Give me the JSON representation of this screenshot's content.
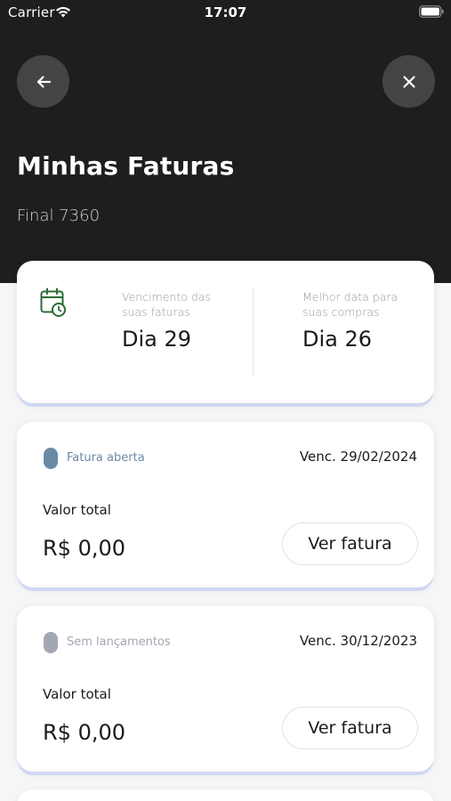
{
  "status_bar": {
    "carrier": "Carrier",
    "time": "17:07"
  },
  "header": {
    "back_icon": "arrow-left-icon",
    "close_icon": "close-icon",
    "title": "Minhas Faturas",
    "subtitle": "Final 7360"
  },
  "summary": {
    "icon": "calendar-clock-icon",
    "due_label": "Vencimento das suas faturas",
    "due_value": "Dia 29",
    "best_label": "Melhor data para suas compras",
    "best_value": "Dia 26"
  },
  "invoices": [
    {
      "status": "Fatura aberta",
      "status_color": "#6b8aa6",
      "due": "Venc. 29/02/2024",
      "total_label": "Valor total",
      "total_value": "R$ 0,00",
      "button": "Ver fatura"
    },
    {
      "status": "Sem lançamentos",
      "status_color": "#a3a7b2",
      "due": "Venc. 30/12/2023",
      "total_label": "Valor total",
      "total_value": "R$ 0,00",
      "button": "Ver fatura"
    }
  ],
  "colors": {
    "header_bg": "#1e1e1e",
    "accent_green": "#2e6b35"
  }
}
